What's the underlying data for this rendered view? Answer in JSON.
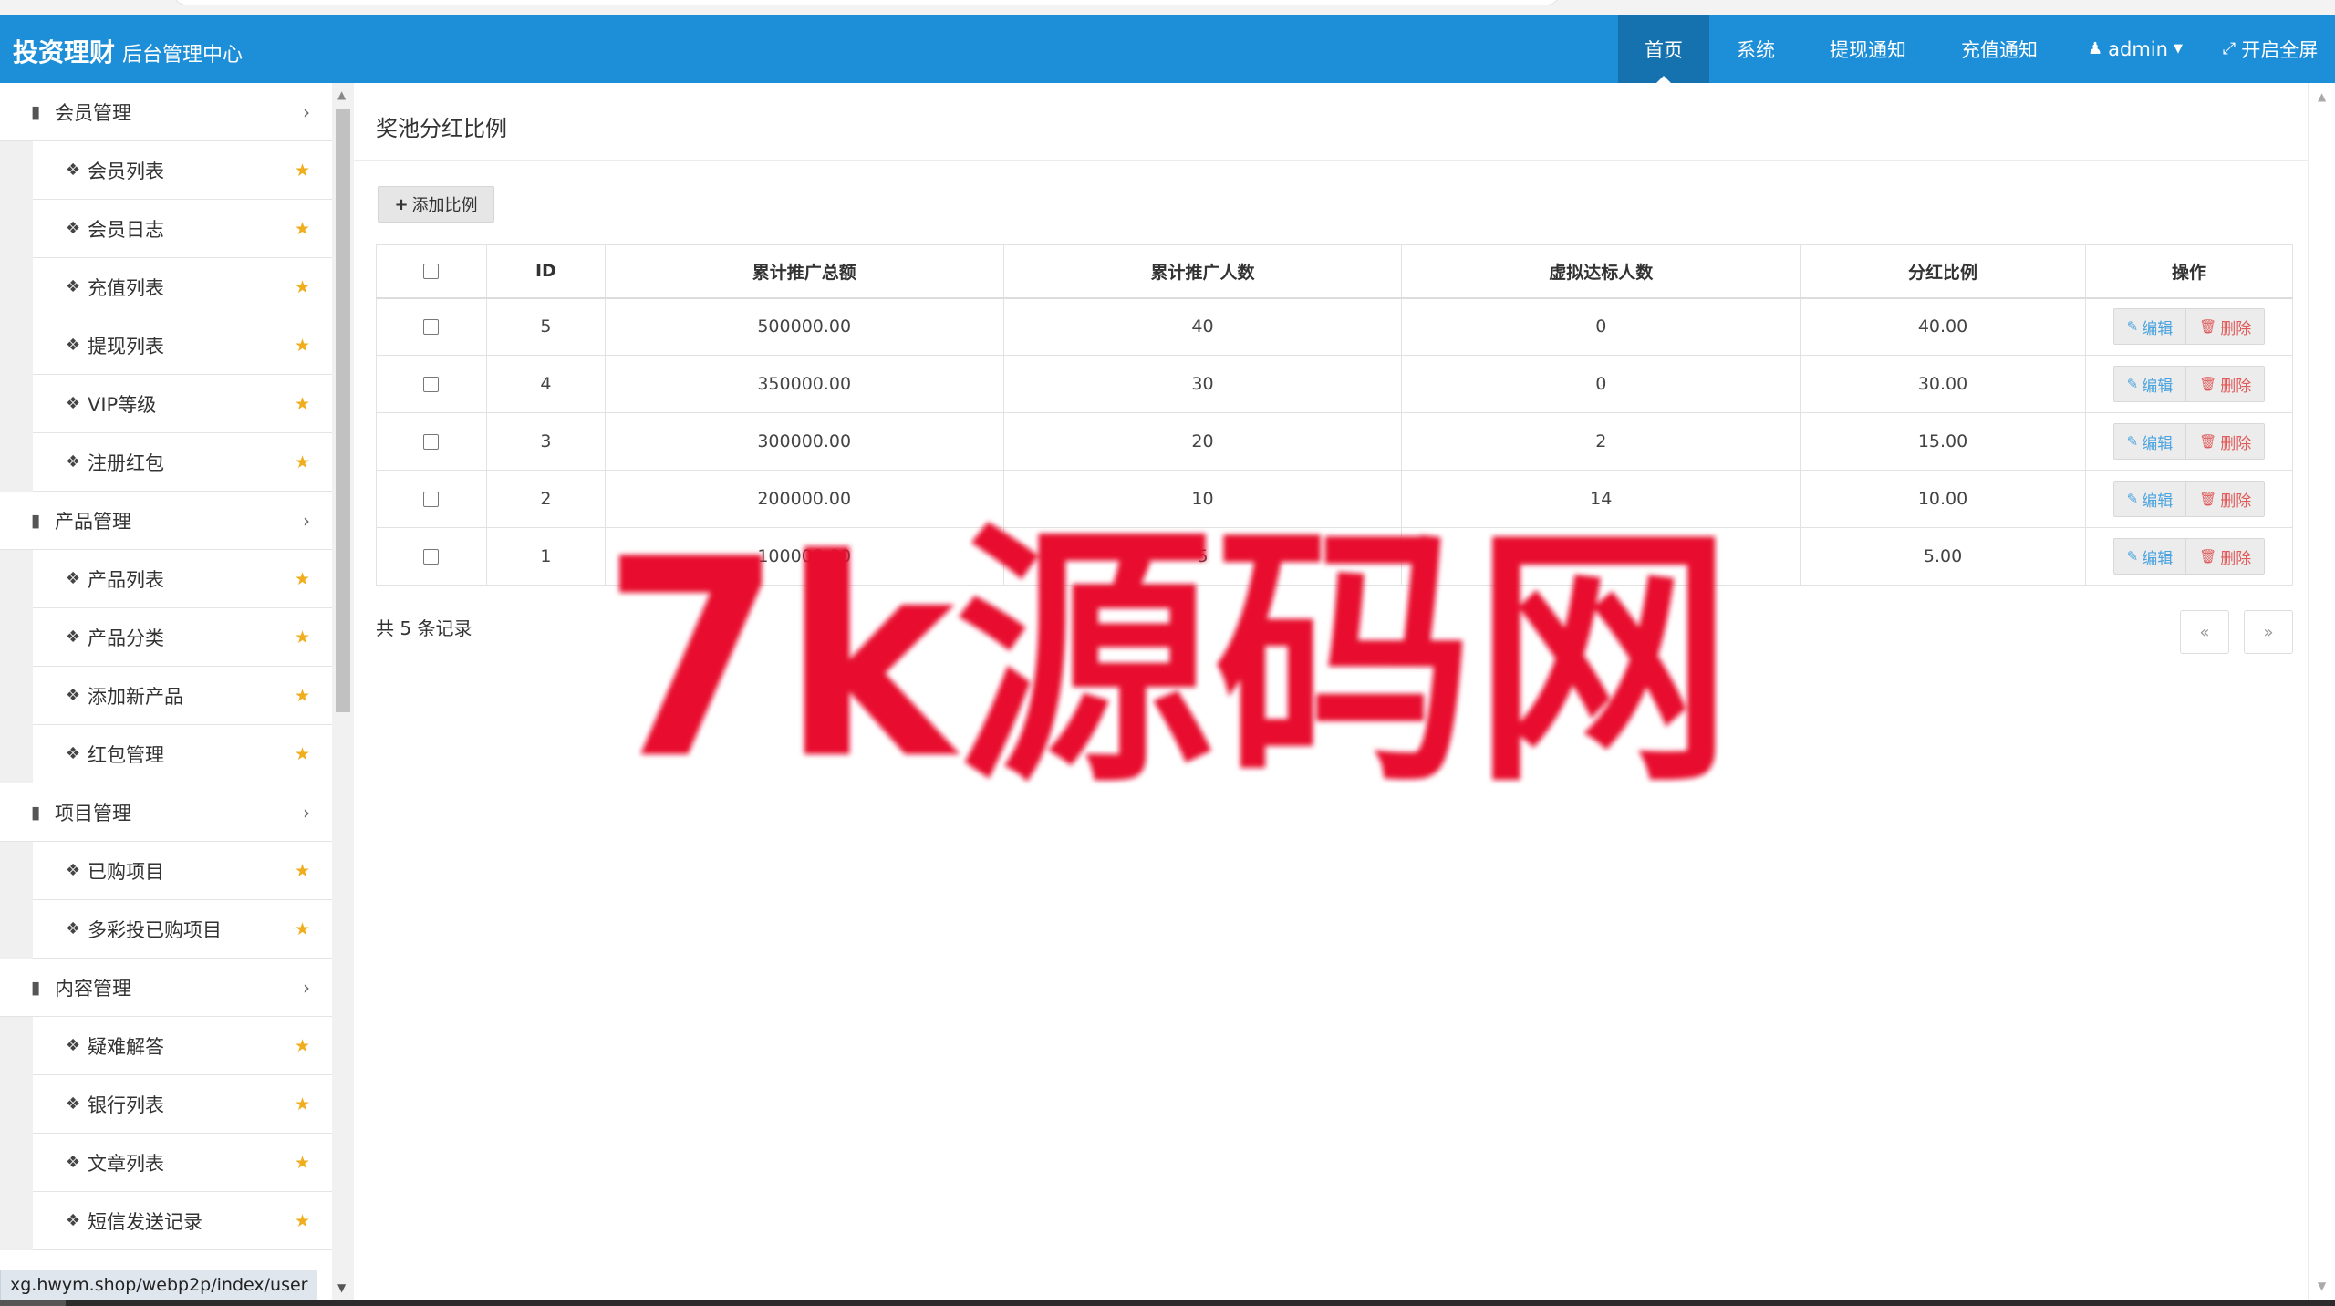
{
  "header": {
    "brand_title": "投资理财",
    "brand_sub": "后台管理中心",
    "nav": [
      {
        "label": "首页",
        "active": true
      },
      {
        "label": "系统"
      },
      {
        "label": "提现通知"
      },
      {
        "label": "充值通知"
      },
      {
        "label": "admin",
        "icon": "user-icon"
      },
      {
        "label": "开启全屏",
        "icon": "fullscreen-icon"
      }
    ]
  },
  "sidebar": {
    "groups": [
      {
        "label": "会员管理",
        "items": [
          "会员列表",
          "会员日志",
          "充值列表",
          "提现列表",
          "VIP等级",
          "注册红包"
        ]
      },
      {
        "label": "产品管理",
        "items": [
          "产品列表",
          "产品分类",
          "添加新产品",
          "红包管理"
        ]
      },
      {
        "label": "项目管理",
        "items": [
          "已购项目",
          "多彩投已购项目"
        ]
      },
      {
        "label": "内容管理",
        "items": [
          "疑难解答",
          "银行列表",
          "文章列表",
          "短信发送记录"
        ]
      }
    ]
  },
  "status_url": "xg.hwym.shop/webp2p/index/user",
  "main": {
    "page_title": "奖池分红比例",
    "add_button": "添加比例",
    "columns": [
      "ID",
      "累计推广总额",
      "累计推广人数",
      "虚拟达标人数",
      "分红比例",
      "操作"
    ],
    "rows": [
      {
        "id": "5",
        "total": "500000.00",
        "count": "40",
        "virtual": "0",
        "ratio": "40.00"
      },
      {
        "id": "4",
        "total": "350000.00",
        "count": "30",
        "virtual": "0",
        "ratio": "30.00"
      },
      {
        "id": "3",
        "total": "300000.00",
        "count": "20",
        "virtual": "2",
        "ratio": "15.00"
      },
      {
        "id": "2",
        "total": "200000.00",
        "count": "10",
        "virtual": "14",
        "ratio": "10.00"
      },
      {
        "id": "1",
        "total": "100000.00",
        "count": "5",
        "virtual": "",
        "ratio": "5.00"
      }
    ],
    "edit_label": "编辑",
    "delete_label": "删除",
    "total_text": "共 5 条记录",
    "pager_prev": "«",
    "pager_next": "»"
  },
  "watermark": "7k源码网",
  "colors": {
    "header_bg": "#1d8fd8",
    "nav_active": "#1572ae",
    "star": "#f0ad1e",
    "watermark": "#e8102e"
  }
}
